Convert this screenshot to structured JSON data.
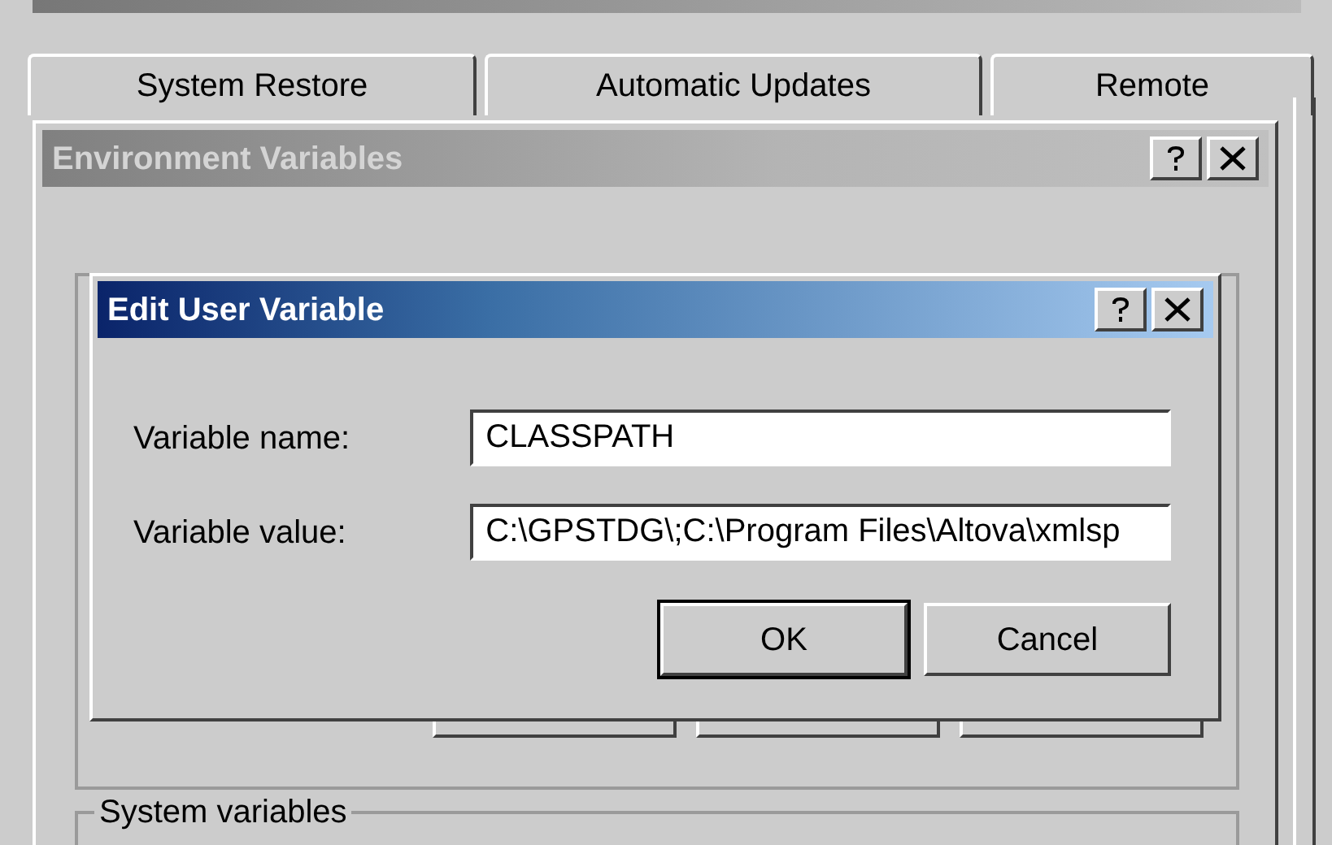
{
  "system_properties": {
    "tabs": [
      {
        "label": "System Restore",
        "selected": false
      },
      {
        "label": "Automatic Updates",
        "selected": false
      },
      {
        "label": "Remote",
        "selected": false
      }
    ]
  },
  "environment_variables": {
    "title": "Environment Variables",
    "active": false,
    "system_variables_label": "System variables"
  },
  "edit_user_variable": {
    "title": "Edit User Variable",
    "active": true,
    "fields": [
      {
        "label": "Variable name:",
        "value": "CLASSPATH"
      },
      {
        "label": "Variable value:",
        "value": "C:\\GPSTDG\\;C:\\Program Files\\Altova\\xmlsp"
      }
    ],
    "buttons": [
      {
        "label": "OK",
        "default": true
      },
      {
        "label": "Cancel",
        "default": false
      }
    ]
  }
}
